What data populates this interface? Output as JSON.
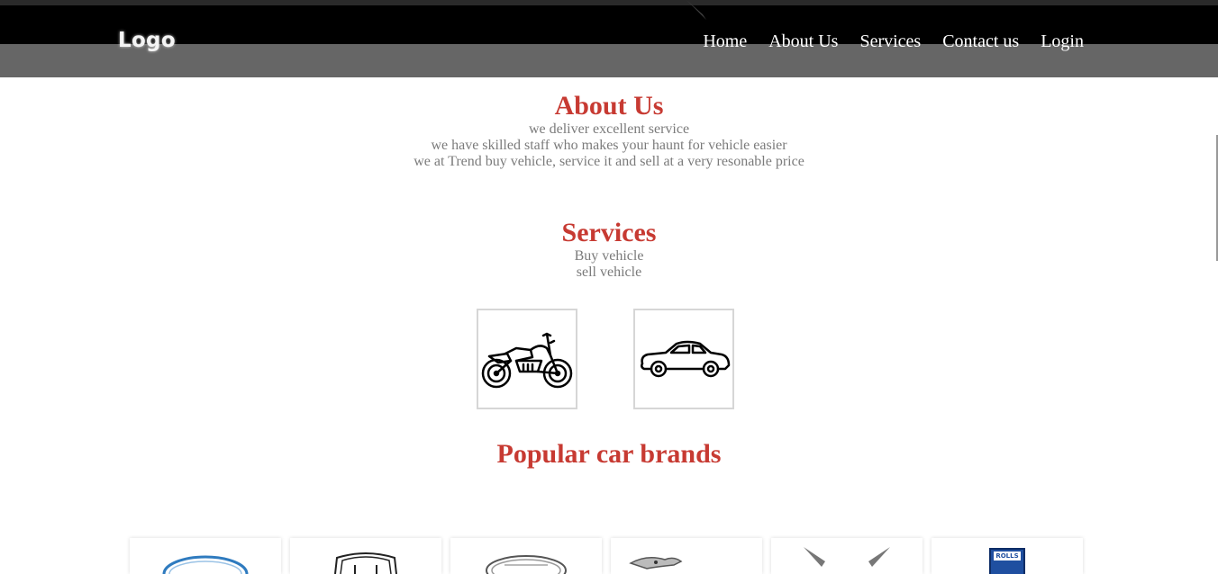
{
  "header": {
    "logo": "Logo",
    "nav": [
      "Home",
      "About Us",
      "Services",
      "Contact us",
      "Login"
    ]
  },
  "about": {
    "title": "About Us",
    "lines": [
      "we deliver excellent service",
      "we have skilled staff who makes your haunt for vehicle easier",
      "we at Trend buy vehicle, service it and sell at a very resonable price"
    ]
  },
  "services": {
    "title": "Services",
    "lines": [
      "Buy vehicle",
      "sell vehicle"
    ],
    "icons": [
      "motorcycle-icon",
      "car-icon"
    ]
  },
  "brands": {
    "title": "Popular car brands",
    "logos": [
      "ford-logo",
      "honda-logo",
      "car-brand-logo",
      "jaguar-logo",
      "brand-logo",
      "rolls-royce-logo"
    ],
    "rolls_label": "ROLLS"
  },
  "colors": {
    "accent": "#c73a32",
    "text_grey": "#7b7b7b",
    "header_dark": "#000000",
    "header_grey": "#666666"
  }
}
